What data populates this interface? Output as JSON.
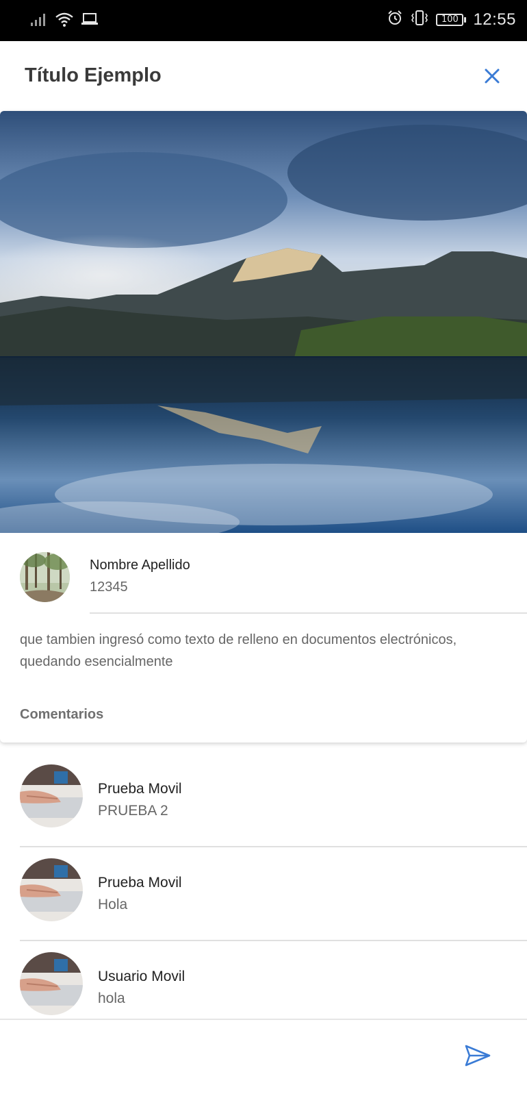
{
  "status_bar": {
    "time": "12:55",
    "battery": "100",
    "icons": [
      "signal-icon",
      "wifi-icon",
      "laptop-icon",
      "alarm-icon",
      "vibrate-icon",
      "battery-icon"
    ]
  },
  "header": {
    "title": "Título Ejemplo",
    "close_icon": "close-icon"
  },
  "post": {
    "hero_image": "mountain-lake-photo",
    "author": {
      "name": "Nombre Apellido",
      "id": "12345",
      "avatar": "forest-avatar"
    },
    "body": "que tambien ingresó como texto de relleno en documentos electrónicos, quedando esencialmente",
    "comments_label": "Comentarios"
  },
  "comments": [
    {
      "name": "Prueba Movil",
      "text": "PRUEBA 2",
      "avatar": "hand-keyboard-avatar"
    },
    {
      "name": "Prueba Movil",
      "text": "Hola",
      "avatar": "hand-keyboard-avatar"
    },
    {
      "name": "Usuario Movil",
      "text": "hola",
      "avatar": "hand-keyboard-avatar"
    }
  ],
  "composer": {
    "placeholder": "",
    "send_icon": "send-icon"
  },
  "colors": {
    "accent": "#3a7bd5",
    "status_bar": "#000000",
    "divider": "#e0e0e0"
  }
}
